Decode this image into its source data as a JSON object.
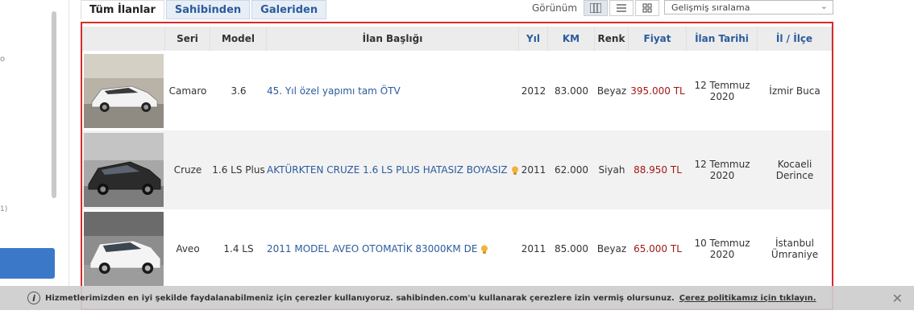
{
  "tabs": [
    {
      "label": "Tüm İlanlar"
    },
    {
      "label": "Sahibinden"
    },
    {
      "label": "Galeriden"
    }
  ],
  "view": {
    "label": "Görünüm"
  },
  "sort": {
    "selected": "Gelişmiş sıralama"
  },
  "left": {
    "mark1": "o",
    "mark2": "1)"
  },
  "headers": [
    "Seri",
    "Model",
    "İlan Başlığı",
    "Yıl",
    "KM",
    "Renk",
    "Fiyat",
    "İlan Tarihi",
    "İl / İlçe"
  ],
  "rows": [
    {
      "seri": "Camaro",
      "model": "3.6",
      "title": "45. Yıl özel yapımı tam ÖTV",
      "bulb": false,
      "year": "2012",
      "km": "83.000",
      "color": "Beyaz",
      "price": "395.000 TL",
      "date": "12 Temmuz 2020",
      "location": "İzmir Buca"
    },
    {
      "seri": "Cruze",
      "model": "1.6 LS Plus",
      "title": "AKTÜRKTEN CRUZE 1.6 LS PLUS HATASIZ BOYASIZ",
      "bulb": true,
      "year": "2011",
      "km": "62.000",
      "color": "Siyah",
      "price": "88.950 TL",
      "date": "12 Temmuz 2020",
      "location": "Kocaeli Derince"
    },
    {
      "seri": "Aveo",
      "model": "1.4 LS",
      "title": "2011 MODEL AVEO OTOMATİK 83000KM DE",
      "bulb": true,
      "year": "2011",
      "km": "85.000",
      "color": "Beyaz",
      "price": "65.000 TL",
      "date": "10 Temmuz 2020",
      "location": "İstanbul Ümraniye"
    }
  ],
  "cookie": {
    "message": "Hizmetlerimizden en iyi şekilde faydalanabilmeniz için çerezler kullanıyoruz. sahibinden.com'u kullanarak çerezlere izin vermiş olursunuz.",
    "link": "Çerez politikamız için tıklayın."
  },
  "colors": {
    "accent": "#2b5b9c",
    "price": "#a01818",
    "highlight": "#d62b2b"
  }
}
